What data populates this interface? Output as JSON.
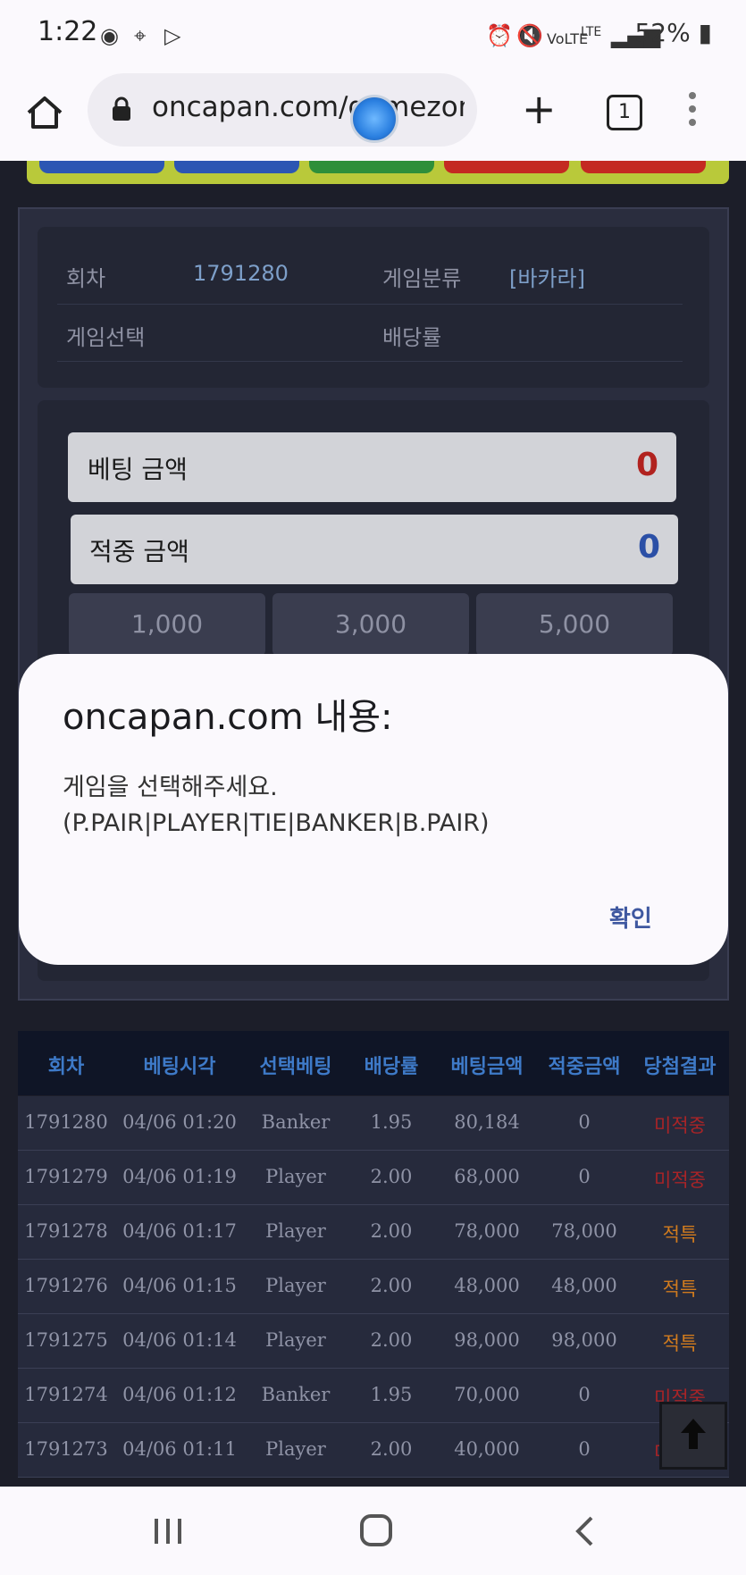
{
  "status_bar": {
    "time": "1:22",
    "battery": "52%",
    "network": "LTE"
  },
  "browser": {
    "url": "oncapan.com/gamezone",
    "tab_count": "1"
  },
  "game_info": {
    "round_label": "회차",
    "round_value": "1791280",
    "category_label": "게임분류",
    "category_value": "[바카라]",
    "select_label": "게임선택",
    "odds_label": "배당률"
  },
  "bet_panel": {
    "bet_amount_label": "베팅 금액",
    "bet_amount_value": "0",
    "win_amount_label": "적중 금액",
    "win_amount_value": "0",
    "chips": [
      "1,000",
      "3,000",
      "5,000"
    ]
  },
  "dialog": {
    "title": "oncapan.com 내용:",
    "message": "게임을 선택해주세요.\n(P.PAIR|PLAYER|TIE|BANKER|B.PAIR)",
    "ok_label": "확인"
  },
  "history_table": {
    "headers": [
      "회차",
      "베팅시각",
      "선택베팅",
      "배당률",
      "베팅금액",
      "적중금액",
      "당첨결과"
    ],
    "rows": [
      [
        "1791280",
        "04/06 01:20",
        "Banker",
        "1.95",
        "80,184",
        "0",
        "미적중"
      ],
      [
        "1791279",
        "04/06 01:19",
        "Player",
        "2.00",
        "68,000",
        "0",
        "미적중"
      ],
      [
        "1791278",
        "04/06 01:17",
        "Player",
        "2.00",
        "78,000",
        "78,000",
        "적특"
      ],
      [
        "1791276",
        "04/06 01:15",
        "Player",
        "2.00",
        "48,000",
        "48,000",
        "적특"
      ],
      [
        "1791275",
        "04/06 01:14",
        "Player",
        "2.00",
        "98,000",
        "98,000",
        "적특"
      ],
      [
        "1791274",
        "04/06 01:12",
        "Banker",
        "1.95",
        "70,000",
        "0",
        "미적중"
      ],
      [
        "1791273",
        "04/06 01:11",
        "Player",
        "2.00",
        "40,000",
        "0",
        "미적중"
      ]
    ]
  },
  "colors": {
    "lose": "#a82427",
    "win": "#d07b1e",
    "bet_value": "#b1221f",
    "win_value": "#2b4fa6",
    "dialog_ok": "#3f58a0"
  }
}
